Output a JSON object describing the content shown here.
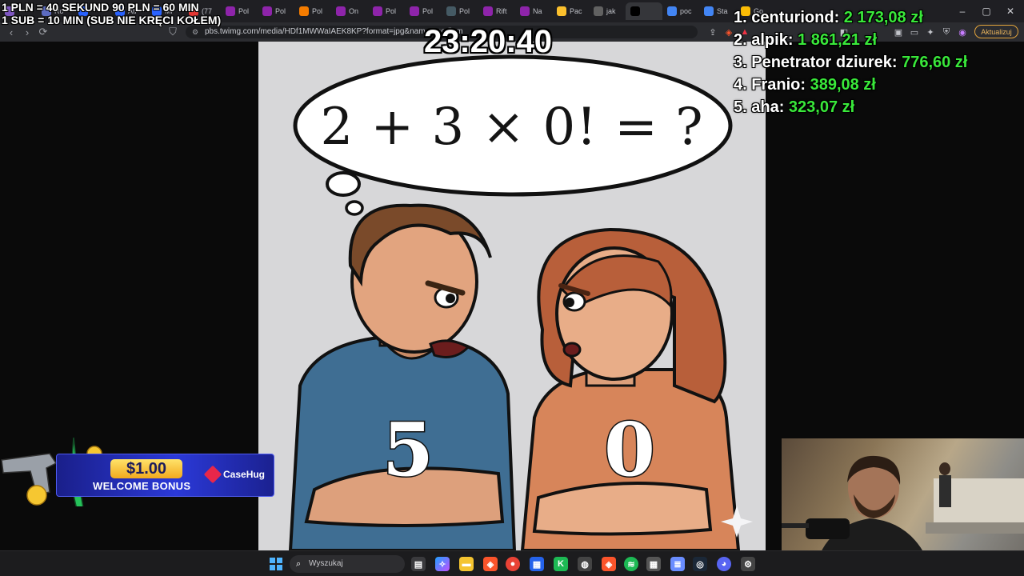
{
  "browser": {
    "tabs": [
      {
        "label": "",
        "color": "#7e57c2"
      },
      {
        "label": "Ro",
        "color": "#5c6bc0"
      },
      {
        "label": "",
        "color": "#2962ff"
      },
      {
        "label": "Atl",
        "color": "#2962ff"
      },
      {
        "label": "Mi",
        "color": "#2962ff"
      },
      {
        "label": "(77",
        "color": "#e53935"
      },
      {
        "label": "Pol",
        "color": "#8e24aa"
      },
      {
        "label": "Pol",
        "color": "#8e24aa"
      },
      {
        "label": "Pol",
        "color": "#f57c00"
      },
      {
        "label": "On",
        "color": "#8e24aa"
      },
      {
        "label": "Pol",
        "color": "#8e24aa"
      },
      {
        "label": "Pol",
        "color": "#8e24aa"
      },
      {
        "label": "Pol",
        "color": "#455a64"
      },
      {
        "label": "Rift",
        "color": "#8e24aa"
      },
      {
        "label": "Na",
        "color": "#8e24aa"
      },
      {
        "label": "Pac",
        "color": "#fbc02d"
      },
      {
        "label": "jak",
        "color": "#616161"
      },
      {
        "label": "",
        "color": "#000000"
      },
      {
        "label": "poc",
        "color": "#4285f4"
      },
      {
        "label": "Sta",
        "color": "#4285f4"
      },
      {
        "label": "Go",
        "color": "#fbbc05"
      }
    ],
    "url": "pbs.twimg.com/media/HDf1MWWaIAEK8KP?format=jpg&name=medium",
    "update_label": "Aktualizuj",
    "window_controls": {
      "minimize": "–",
      "maximize": "▢",
      "close": "✕"
    }
  },
  "overlay": {
    "rules_line1": "1 PLN = 40 SEKUND 90 PLN = 60 MIN",
    "rules_line2": "1 SUB = 10 MIN (SUB NIE KRĘCI KOŁEM)",
    "timer": "23:20:40",
    "leaderboard": [
      {
        "rank": "1. centuriond:",
        "amount": "2 173,08 zł"
      },
      {
        "rank": "2. alpik:",
        "amount": "1 861,21 zł"
      },
      {
        "rank": "3. Penetrator dziurek:",
        "amount": "776,60 zł"
      },
      {
        "rank": "4. Franio:",
        "amount": "389,08 zł"
      },
      {
        "rank": "5. aha:",
        "amount": "323,07 zł"
      }
    ]
  },
  "meme": {
    "equation": "2 + 3 × 0! = ?",
    "man_answer": "5",
    "woman_answer": "0"
  },
  "ad": {
    "amount": "$1.00",
    "label": "WELCOME BONUS",
    "brand": "CaseHug"
  },
  "taskbar": {
    "search_placeholder": "Wyszukaj"
  },
  "colors": {
    "leaderboard_amount": "#39e83a",
    "update_accent": "#e3a43b"
  }
}
